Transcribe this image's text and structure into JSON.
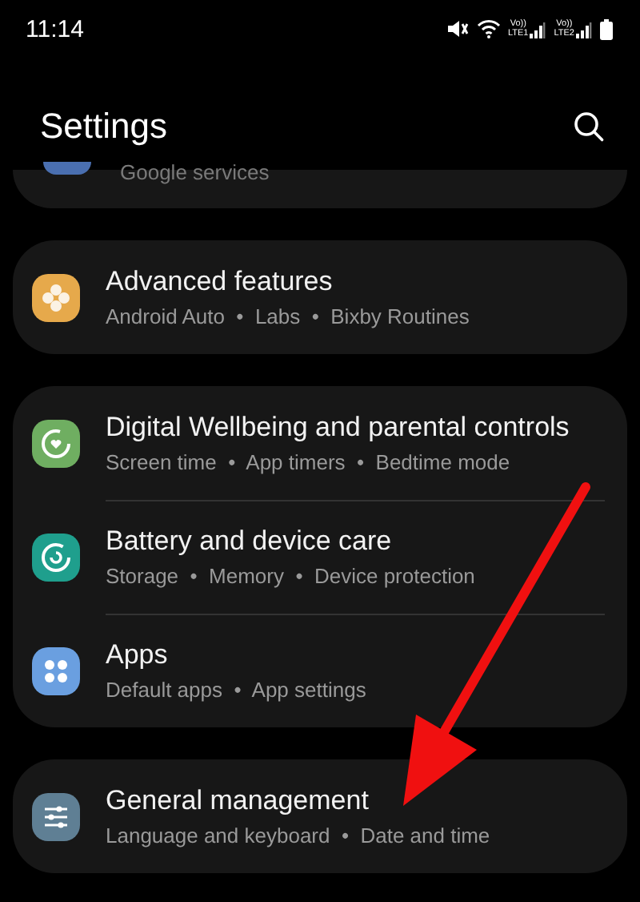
{
  "status_bar": {
    "time": "11:14",
    "sim_labels": [
      {
        "top": "Vo))",
        "bottom": "LTE1"
      },
      {
        "top": "Vo))",
        "bottom": "LTE2"
      }
    ]
  },
  "header": {
    "title": "Settings"
  },
  "partial_item": {
    "subtitle": "Google services"
  },
  "groups": [
    {
      "items": [
        {
          "title": "Advanced features",
          "subtitle": "Android Auto  •  Labs  •  Bixby Routines"
        }
      ]
    },
    {
      "items": [
        {
          "title": "Digital Wellbeing and parental controls",
          "subtitle": "Screen time  •  App timers  •  Bedtime mode"
        },
        {
          "title": "Battery and device care",
          "subtitle": "Storage  •  Memory  •  Device protection"
        },
        {
          "title": "Apps",
          "subtitle": "Default apps  •  App settings"
        }
      ]
    },
    {
      "items": [
        {
          "title": "General management",
          "subtitle": "Language and keyboard  •  Date and time"
        }
      ]
    }
  ]
}
